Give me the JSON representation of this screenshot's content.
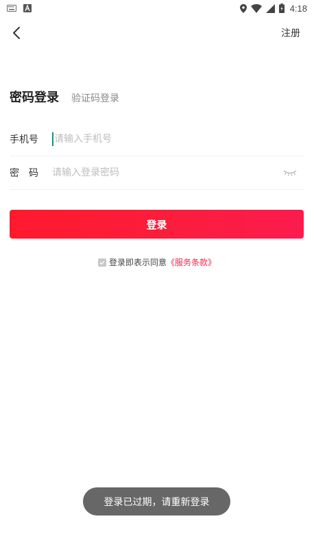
{
  "status_bar": {
    "time": "4:18",
    "icons": [
      "keyboard-icon",
      "android-a-icon",
      "location-icon",
      "wifi-icon",
      "signal-icon",
      "battery-icon"
    ]
  },
  "header": {
    "register_label": "注册"
  },
  "tabs": [
    {
      "label": "密码登录",
      "active": true
    },
    {
      "label": "验证码登录",
      "active": false
    }
  ],
  "form": {
    "phone": {
      "label": "手机号",
      "placeholder": "请输入手机号",
      "value": ""
    },
    "password": {
      "label": "密码",
      "placeholder": "请输入登录密码",
      "value": ""
    }
  },
  "login_button": {
    "label": "登录"
  },
  "agreement": {
    "text": "登录即表示同意",
    "link": "《服务条款》",
    "checked": true
  },
  "toast": {
    "message": "登录已过期，请重新登录"
  },
  "colors": {
    "accent": "#fb1d3a",
    "link": "#f4244c",
    "cursor": "#1d8a7a"
  }
}
